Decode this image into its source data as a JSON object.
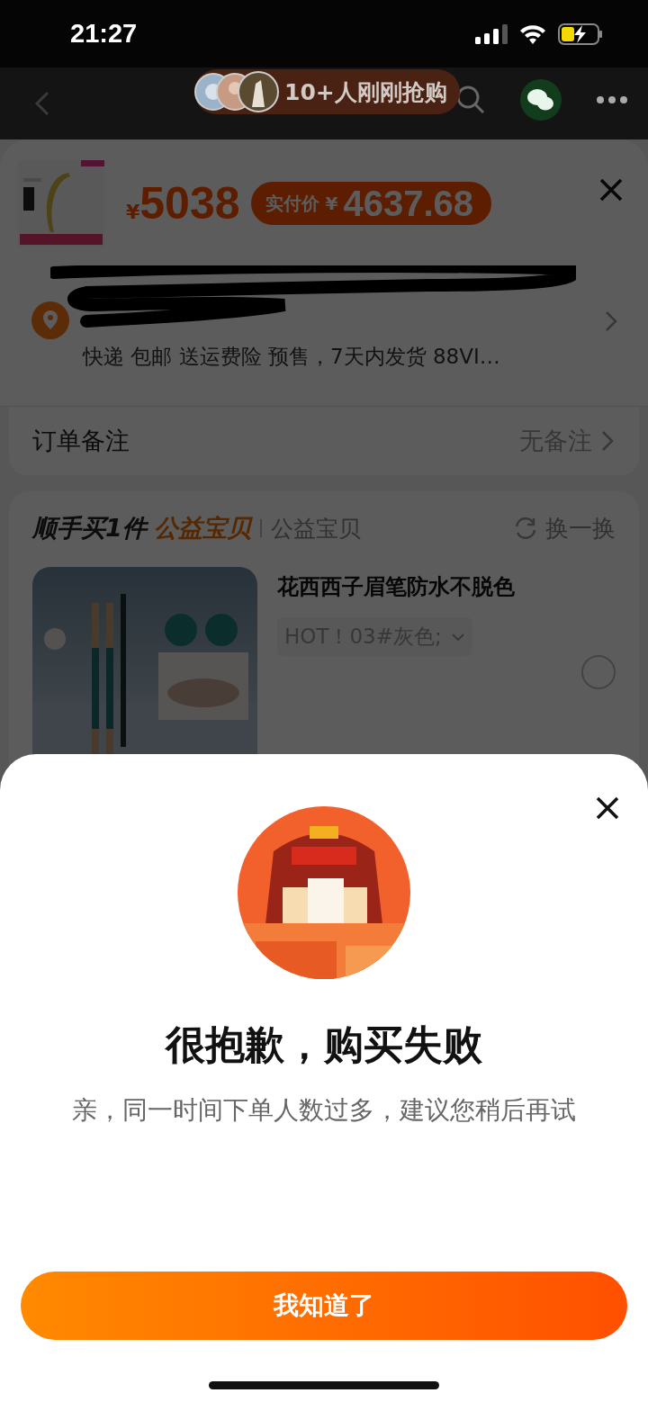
{
  "status_bar": {
    "time": "21:27"
  },
  "nav": {
    "social_proof": "10+人刚刚抢购"
  },
  "order_sheet": {
    "price_symbol": "¥",
    "price": "5038",
    "paid_label": "实付价 ¥",
    "paid_amount": "4637.68",
    "shipping": "快递 包邮 送运费险 预售，7天内发货 88VI…"
  },
  "remark": {
    "label": "订单备注",
    "value": "无备注"
  },
  "addon": {
    "title": "顺手买1件",
    "highlight": "公益宝贝",
    "tag": "公益宝贝",
    "refresh": "换一换",
    "product": {
      "title": "花西西子眉笔防水不脱色",
      "variant": "HOT！03#灰色;",
      "selected": false
    }
  },
  "dialog": {
    "title": "很抱歉，购买失败",
    "message": "亲，同一时间下单人数过多，建议您稍后再试",
    "button": "我知道了"
  }
}
